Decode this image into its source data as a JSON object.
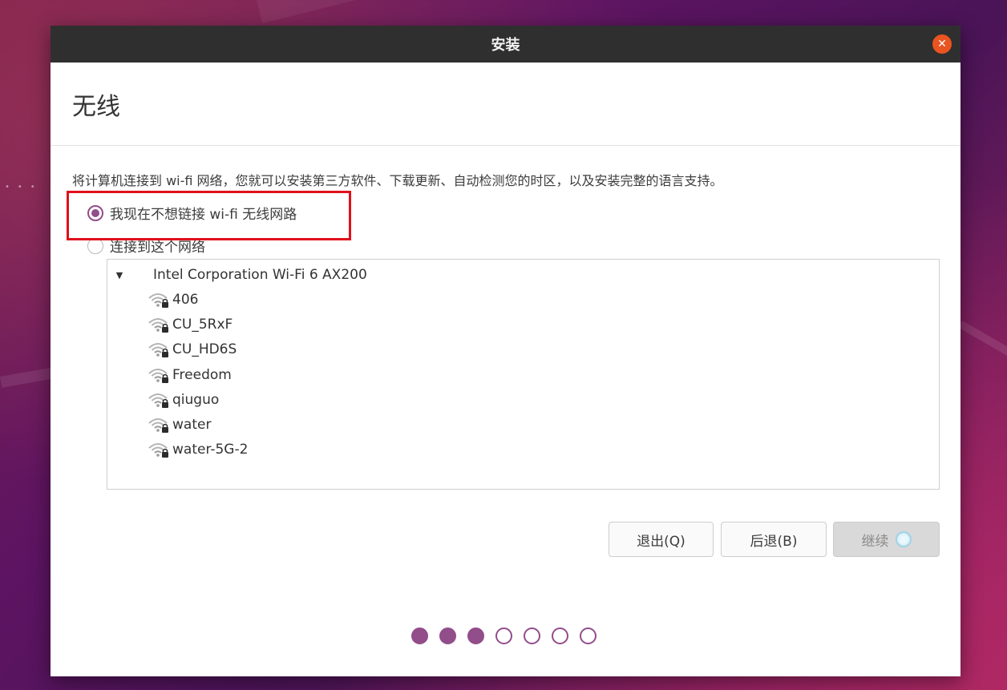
{
  "window": {
    "title": "安装",
    "close_icon": "close-icon"
  },
  "page": {
    "title": "无线",
    "description": "将计算机连接到 wi-fi 网络，您就可以安装第三方软件、下载更新、自动检测您的时区，以及安装完整的语言支持。"
  },
  "options": {
    "no_wifi_label": "我现在不想链接 wi-fi 无线网路",
    "no_wifi_selected": true,
    "connect_label": "连接到这个网络",
    "connect_selected": false
  },
  "network_panel": {
    "adapter": {
      "name": "Intel Corporation Wi-Fi 6 AX200",
      "expanded": true,
      "expander_icon": "triangle-down-icon"
    },
    "networks": [
      {
        "ssid": "406",
        "icon": "wifi-locked-icon"
      },
      {
        "ssid": "CU_5RxF",
        "icon": "wifi-locked-icon"
      },
      {
        "ssid": "CU_HD6S",
        "icon": "wifi-locked-icon"
      },
      {
        "ssid": "Freedom",
        "icon": "wifi-locked-icon"
      },
      {
        "ssid": "qiuguo",
        "icon": "wifi-locked-icon"
      },
      {
        "ssid": "water",
        "icon": "wifi-locked-icon"
      },
      {
        "ssid": "water-5G-2",
        "icon": "wifi-locked-icon"
      }
    ]
  },
  "buttons": {
    "quit": "退出(Q)",
    "back": "后退(B)",
    "continue": "继续"
  },
  "progress": {
    "total_steps": 7,
    "completed_steps": 3
  },
  "colors": {
    "accent": "#924d8b",
    "close": "#e95420",
    "titlebar": "#2f2f2f",
    "highlight": "#e0101c"
  }
}
